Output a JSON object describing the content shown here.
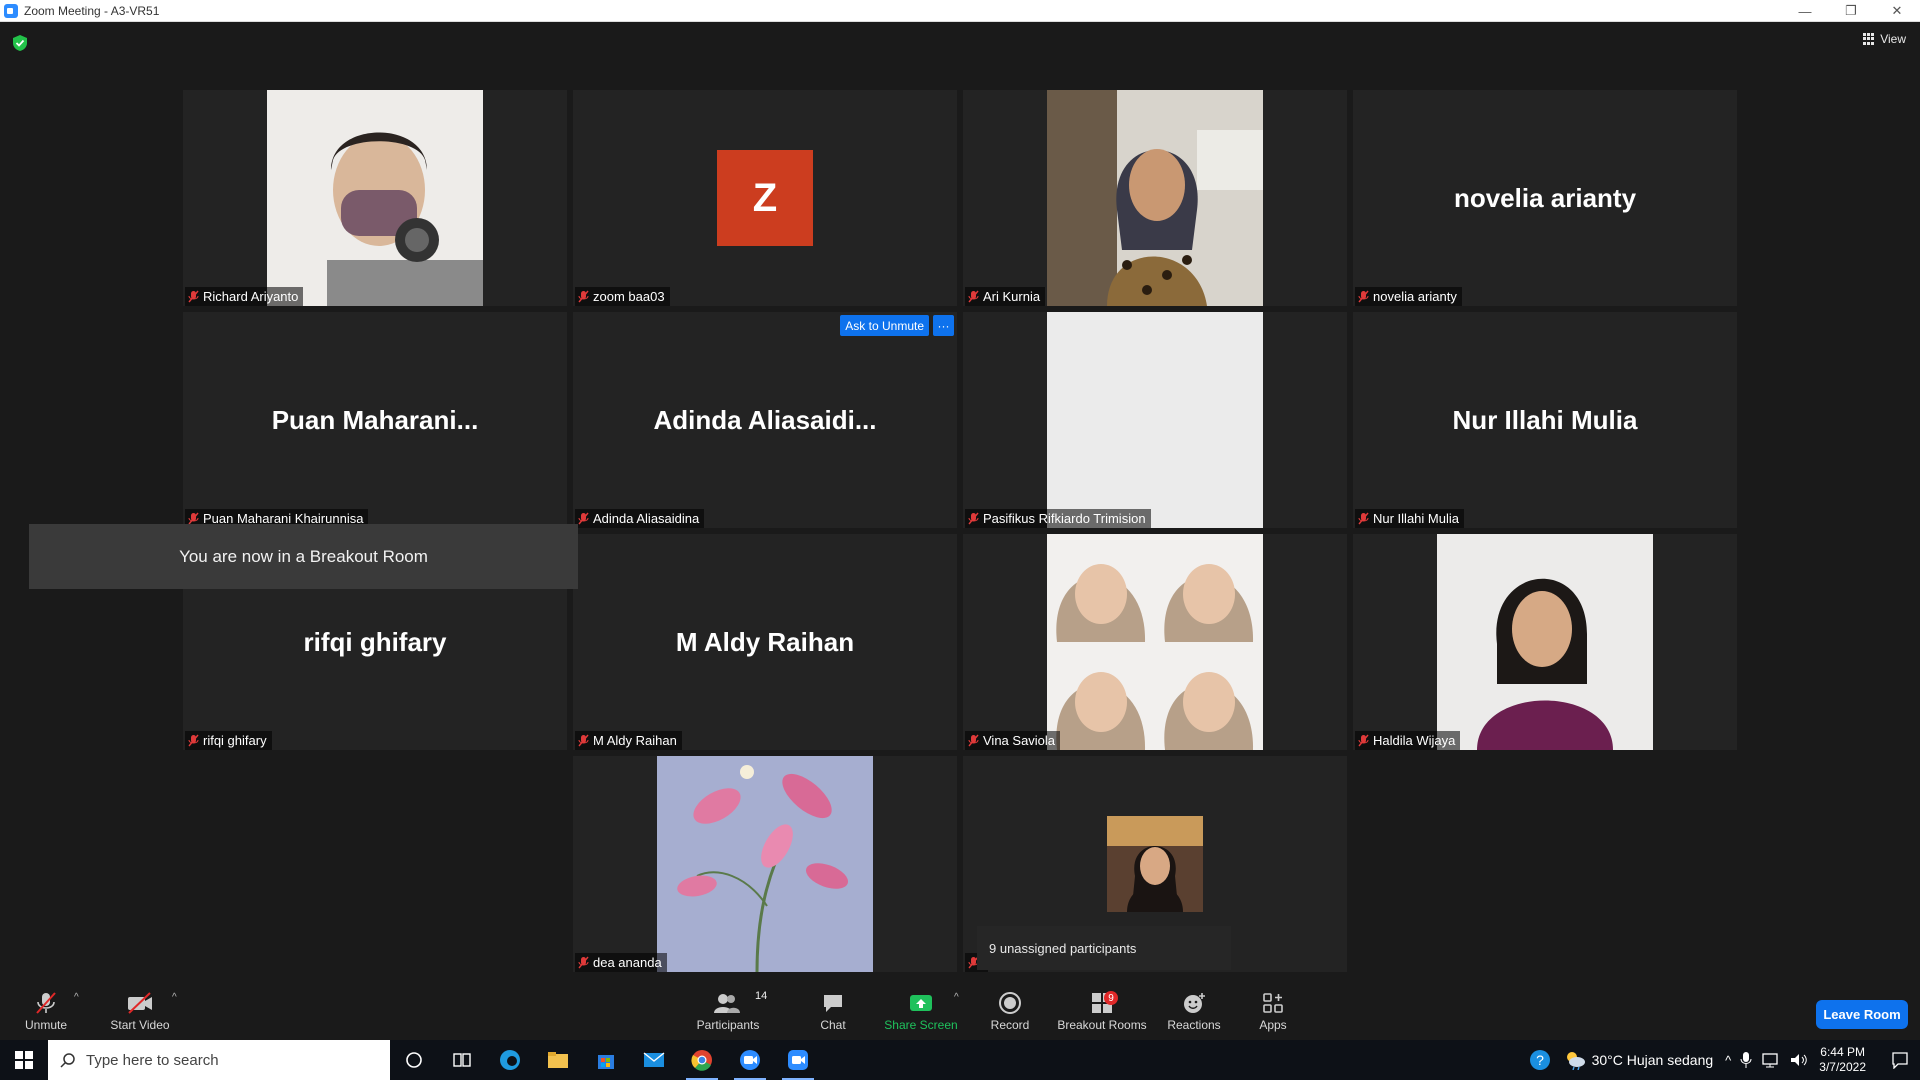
{
  "window": {
    "title": "Zoom Meeting - A3-VR51"
  },
  "header": {
    "view_label": "View"
  },
  "tiles": [
    {
      "big": "",
      "label": "Richard Ariyanto"
    },
    {
      "big": "",
      "label": "zoom baa03",
      "avatar_letter": "Z"
    },
    {
      "big": "",
      "label": "Ari Kurnia"
    },
    {
      "big": "novelia arianty",
      "label": "novelia arianty"
    },
    {
      "big": "Puan  Maharani...",
      "label": "Puan Maharani Khairunnisa"
    },
    {
      "big": "Adinda  Aliasaidi...",
      "label": "Adinda Aliasaidina",
      "ask_unmute": "Ask to Unmute",
      "more": "···"
    },
    {
      "big": "",
      "label": "Pasifikus Rifkiardo Trimision"
    },
    {
      "big": "Nur Illahi Mulia",
      "label": "Nur Illahi Mulia"
    },
    {
      "big": "rifqi ghifary",
      "label": "rifqi ghifary"
    },
    {
      "big": "M Aldy Raihan",
      "label": "M Aldy Raihan"
    },
    {
      "big": "",
      "label": "Vina Saviola"
    },
    {
      "big": "",
      "label": "Haldila Wijaya"
    },
    {
      "big": "",
      "label": "dea ananda"
    },
    {
      "big": "",
      "label": ""
    }
  ],
  "toast": "You are now in a Breakout Room",
  "unassigned": "9 unassigned participants",
  "toolbar": {
    "unmute": "Unmute",
    "start_video": "Start Video",
    "participants": "Participants",
    "participants_count": "14",
    "chat": "Chat",
    "share_screen": "Share Screen",
    "record": "Record",
    "breakout_rooms": "Breakout Rooms",
    "breakout_count": "9",
    "reactions": "Reactions",
    "apps": "Apps",
    "leave": "Leave Room"
  },
  "taskbar": {
    "search_placeholder": "Type here to search",
    "weather": "30°C  Hujan sedang",
    "time": "6:44 PM",
    "date": "3/7/2022"
  },
  "colors": {
    "accent": "#0e72ed",
    "share_green": "#1fc15c",
    "avatar": "#cc3d1f",
    "badge_red": "#e02828"
  }
}
